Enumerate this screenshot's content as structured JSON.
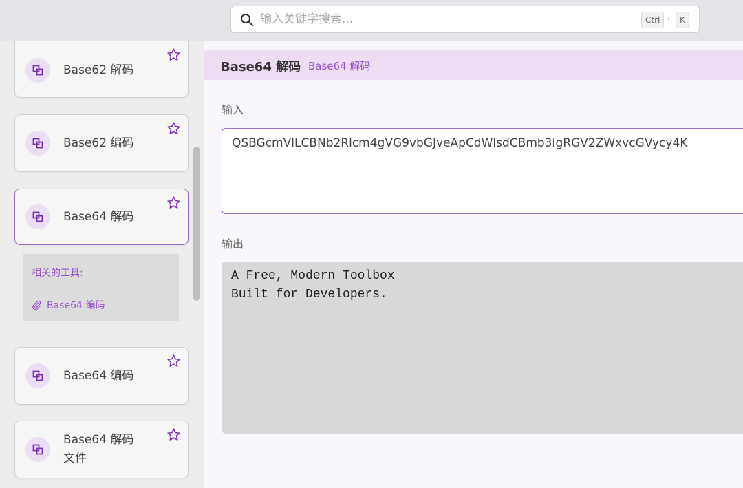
{
  "search": {
    "placeholder": "输入关键字搜索...",
    "shortcut_ctrl": "Ctrl",
    "shortcut_plus": "+",
    "shortcut_key": "K"
  },
  "sidebar": {
    "items": [
      {
        "label": "Base62 解码",
        "icon": "copy-icon",
        "star": "star-icon",
        "active": false
      },
      {
        "label": "Base62 编码",
        "icon": "copy-icon",
        "star": "star-icon",
        "active": false
      },
      {
        "label": "Base64 解码",
        "icon": "copy-icon",
        "star": "star-icon",
        "active": true
      },
      {
        "label": "Base64 编码",
        "icon": "copy-icon",
        "star": "star-icon",
        "active": false
      },
      {
        "label": "Base64 解码",
        "label_line2": "文件",
        "icon": "copy-icon",
        "star": "star-icon",
        "active": false
      }
    ],
    "related": {
      "title": "相关的工具:",
      "link_label": "Base64 编码",
      "link_icon": "paperclip-icon"
    }
  },
  "main": {
    "title": "Base64 解码",
    "breadcrumb": "Base64 解码",
    "input_label": "输入",
    "input_value": "QSBGcmVlLCBNb2Rlcm4gVG9vbGJveApCdWlsdCBmb3IgRGV2ZWxvcGVycy4K",
    "output_label": "输出",
    "output_line1": "A Free, Modern Toolbox",
    "output_line2": "Built for Developers."
  },
  "colors": {
    "accent": "#9a55c9",
    "header_bg": "#eddcf2",
    "icon_bg": "#eadff4",
    "output_bg": "#d8d8d8"
  }
}
